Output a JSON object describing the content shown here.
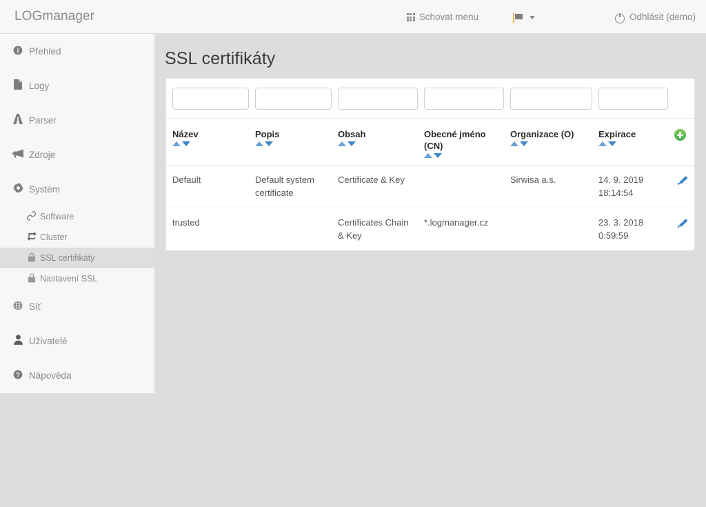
{
  "header": {
    "brand": "LOGmanager",
    "hide_menu_label": "Schovat menu",
    "logout_label": "Odhlásit (demo)",
    "grid_icon": "grid-icon",
    "flag_icon": "flag-icon",
    "caret_icon": "chevron-down-icon",
    "power_icon": "power-icon"
  },
  "sidebar": {
    "items": [
      {
        "label": "Přehled",
        "icon": "info-icon",
        "glyph": "ℹ",
        "sub": false,
        "active": false
      },
      {
        "label": "Logy",
        "icon": "file-icon",
        "glyph": "὜B",
        "sub": false,
        "active": false
      },
      {
        "label": "Parser",
        "icon": "road-icon",
        "glyph": "A",
        "sub": false,
        "active": false
      },
      {
        "label": "Zdroje",
        "icon": "bullhorn-icon",
        "glyph": "὎2",
        "sub": false,
        "active": false
      },
      {
        "label": "Systém",
        "icon": "gear-icon",
        "glyph": "⚙",
        "sub": false,
        "active": false
      },
      {
        "label": "Software",
        "icon": "link-icon",
        "glyph": "ὑ7",
        "sub": true,
        "active": false
      },
      {
        "label": "Cluster",
        "icon": "exchange-icon",
        "glyph": "⇄",
        "sub": true,
        "active": false
      },
      {
        "label": "SSL certifikáty",
        "icon": "lock-icon",
        "glyph": "ὑ2",
        "sub": true,
        "active": true
      },
      {
        "label": "Nastavení SSL",
        "icon": "lock-icon",
        "glyph": "ὑ2",
        "sub": true,
        "active": false
      },
      {
        "label": "Síť",
        "icon": "globe-icon",
        "glyph": "ἱ0",
        "sub": false,
        "active": false
      },
      {
        "label": "Uživatelé",
        "icon": "user-icon",
        "glyph": "὆4",
        "sub": false,
        "active": false
      },
      {
        "label": "Nápověda",
        "icon": "question-icon",
        "glyph": "?",
        "sub": false,
        "active": false
      }
    ]
  },
  "main": {
    "title": "SSL certifikáty",
    "filters": [
      {
        "name": "filter-nazev",
        "value": "",
        "placeholder": ""
      },
      {
        "name": "filter-popis",
        "value": "",
        "placeholder": ""
      },
      {
        "name": "filter-obsah",
        "value": "",
        "placeholder": ""
      },
      {
        "name": "filter-cn",
        "value": "",
        "placeholder": ""
      },
      {
        "name": "filter-organizace",
        "value": "",
        "placeholder": ""
      },
      {
        "name": "filter-expirace",
        "value": "",
        "placeholder": ""
      }
    ],
    "table": {
      "columns": [
        {
          "label": "Název",
          "sortable": true
        },
        {
          "label": "Popis",
          "sortable": true
        },
        {
          "label": "Obsah",
          "sortable": true
        },
        {
          "label": "Obecné jméno (CN)",
          "sortable": true
        },
        {
          "label": "Organizace (O)",
          "sortable": true
        },
        {
          "label": "Expirace",
          "sortable": true
        }
      ],
      "add_button_label": "",
      "rows": [
        {
          "nazev": "Default",
          "popis": "Default system certificate",
          "obsah": "Certificate & Key",
          "cn": "",
          "organizace": "Sirwisa a.s.",
          "expirace": "14. 9. 2019 18:14:54"
        },
        {
          "nazev": "trusted",
          "popis": "",
          "obsah": "Certificates Chain & Key",
          "cn": "*.logmanager.cz",
          "organizace": "",
          "expirace": "23. 3. 2018 0:59:59"
        }
      ]
    }
  },
  "colors": {
    "page_background": "#dddddd",
    "panel_background": "#ffffff",
    "sidebar_background": "#f7f7f7",
    "sidebar_active": "#dedede",
    "text_muted": "#8a8a8a",
    "title": "#3b3b3b",
    "sort_arrow_up": "#6aa3d5",
    "sort_arrow_down": "#3e87cb",
    "add_green": "#4db054",
    "edit_blue": "#3e87cb",
    "flag_pole": "#e8b84b"
  }
}
